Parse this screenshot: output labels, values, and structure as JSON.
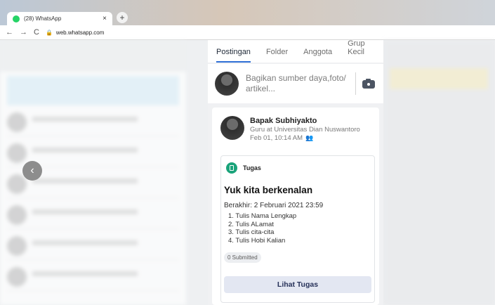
{
  "browser": {
    "tab_title": "(28) WhatsApp",
    "tab_close": "×",
    "new_tab": "+",
    "back": "←",
    "forward": "→",
    "reload": "C",
    "url": "web.whatsapp.com"
  },
  "overlay": {
    "back_arrow": "‹"
  },
  "panel": {
    "tabs": [
      {
        "label": "Postingan",
        "active": true
      },
      {
        "label": "Folder",
        "active": false
      },
      {
        "label": "Anggota",
        "active": false
      },
      {
        "label": "Grup Kecil",
        "active": false
      }
    ],
    "share_placeholder": "Bagikan sumber daya,foto/ artikel...",
    "post": {
      "author_name": "Bapak Subhiyakto",
      "author_role": "Guru at Universitas Dian Nuswantoro",
      "timestamp": "Feb 01, 10:14 AM",
      "audience_icon": "people-icon",
      "type_label": "Tugas",
      "title": "Yuk kita berkenalan",
      "deadline": "Berakhir: 2 Februari 2021 23:59",
      "items": [
        "1. Tulis Nama Lengkap",
        "2. Tulis ALamat",
        "3. Tulis cita-cita",
        "4. Tulis Hobi Kalian"
      ],
      "submitted": "0 Submitted",
      "view_button": "Lihat Tugas"
    }
  },
  "colors": {
    "active_tab": "#2f6fd6",
    "assignment_icon": "#1aa37a",
    "button_bg": "#e3e7f2",
    "whatsapp_green": "#25d366"
  }
}
